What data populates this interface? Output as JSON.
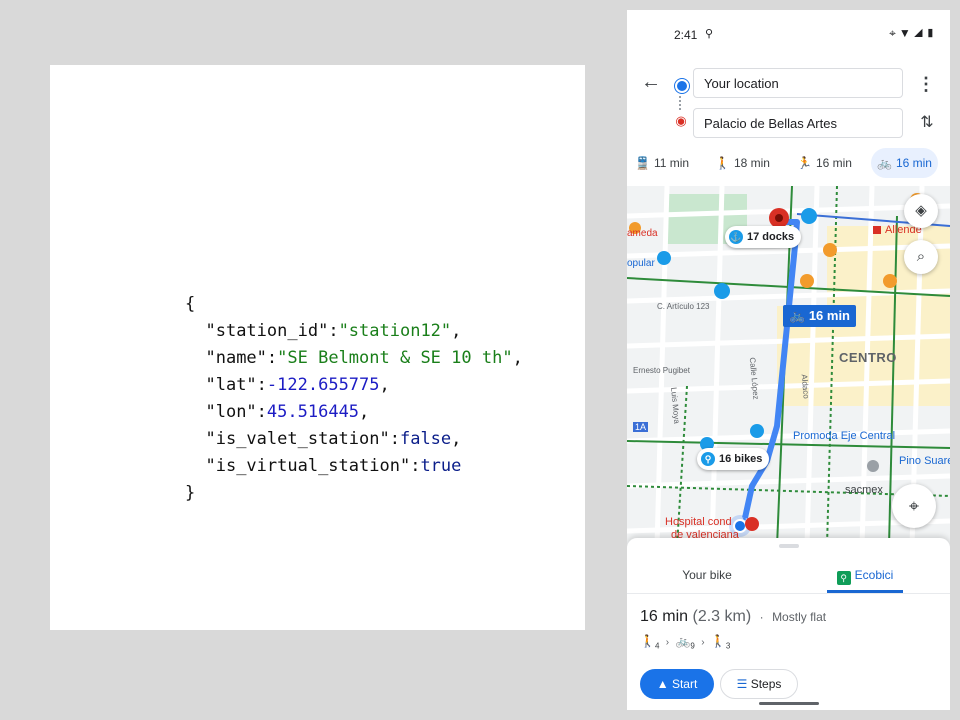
{
  "code": {
    "open_brace": "{",
    "close_brace": "}",
    "fields": [
      {
        "key": "\"station_id\"",
        "value": "\"station12\"",
        "type": "s",
        "comma": ","
      },
      {
        "key": "\"name\"",
        "value": "\"SE Belmont & SE 10 th\"",
        "type": "s",
        "comma": ","
      },
      {
        "key": "\"lat\"",
        "value": "-122.655775",
        "type": "n",
        "comma": ","
      },
      {
        "key": "\"lon\"",
        "value": "45.516445",
        "type": "n",
        "comma": ","
      },
      {
        "key": "\"is_valet_station\"",
        "value": "false",
        "type": "b",
        "comma": ","
      },
      {
        "key": "\"is_virtual_station\"",
        "value": "true",
        "type": "b",
        "comma": ""
      }
    ]
  },
  "status_bar": {
    "time": "2:41",
    "extra": "⚲",
    "icons": "⌖▼◢▮"
  },
  "directions": {
    "from": "Your location",
    "to": "Palacio de Bellas Artes",
    "back_icon": "arrow-back-icon",
    "more_icon": "more-vert-icon",
    "swap_icon": "swap-icon"
  },
  "modes": [
    {
      "icon": "🚆",
      "label": "11 min",
      "active": false
    },
    {
      "icon": "🚶",
      "label": "18 min",
      "active": false
    },
    {
      "icon": "🏃",
      "label": "16 min",
      "active": false
    },
    {
      "icon": "🚲",
      "label": "16 min",
      "active": true
    }
  ],
  "map": {
    "bubble_docks": "17 docks",
    "bubble_bikes": "16 bikes",
    "route_time": "16 min",
    "labels": {
      "centro": "CENTRO",
      "allende": "Allende",
      "promoda": "Promoda Eje Central",
      "pino": "Pino Suare",
      "sacmex": "sacmex",
      "hospital1": "Hospital cond",
      "hospital2": "de valenciana",
      "articulo": "C. Artículo 123",
      "pugibet": "Ernesto Pugibet",
      "lopez": "Calle López",
      "aldaco": "Aldaco",
      "luis_moya": "Luis Moya",
      "ameda": "ameda",
      "opular": "opular",
      "eje": "1A"
    }
  },
  "sheet": {
    "tabs": [
      "Your bike",
      "Ecobici"
    ],
    "active_tab": 1,
    "duration": "16 min",
    "distance": "(2.3 km)",
    "terrain": "Mostly flat",
    "steps": [
      {
        "icon": "🚶",
        "n": "4"
      },
      {
        "icon": "🚲",
        "n": "9"
      },
      {
        "icon": "🚶",
        "n": "3"
      }
    ],
    "start_label": "Start",
    "steps_label": "Steps"
  },
  "colors": {
    "accent": "#1a73e8",
    "route": "#4285f4",
    "json_string": "#1a7f1a",
    "json_number": "#1c1cc4"
  }
}
